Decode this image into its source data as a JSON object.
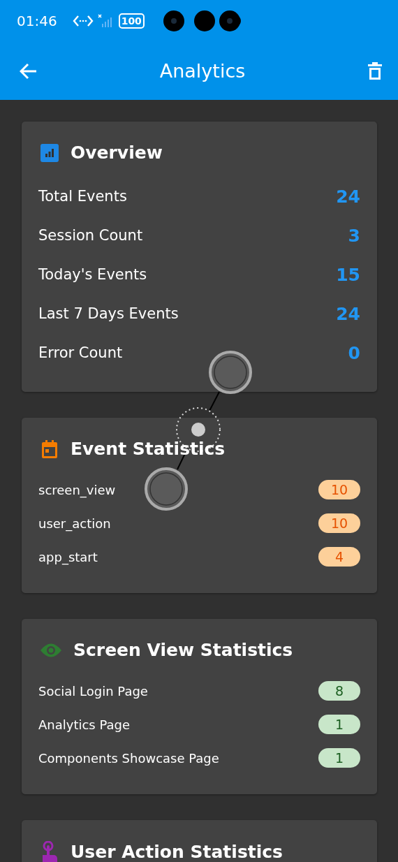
{
  "status_bar": {
    "time": "01:46",
    "battery": "100"
  },
  "app_bar": {
    "title": "Analytics"
  },
  "sections": [
    {
      "kind": "overview",
      "title": "Overview",
      "rows": [
        {
          "label": "Total Events",
          "value": "24"
        },
        {
          "label": "Session Count",
          "value": "3"
        },
        {
          "label": "Today's Events",
          "value": "15"
        },
        {
          "label": "Last 7 Days Events",
          "value": "24"
        },
        {
          "label": "Error Count",
          "value": "0"
        }
      ]
    },
    {
      "kind": "events",
      "title": "Event Statistics",
      "rows": [
        {
          "label": "screen_view",
          "value": "10"
        },
        {
          "label": "user_action",
          "value": "10"
        },
        {
          "label": "app_start",
          "value": "4"
        }
      ]
    },
    {
      "kind": "screens",
      "title": "Screen View Statistics",
      "rows": [
        {
          "label": "Social Login Page",
          "value": "8"
        },
        {
          "label": "Analytics Page",
          "value": "1"
        },
        {
          "label": "Components Showcase Page",
          "value": "1"
        }
      ]
    },
    {
      "kind": "actions",
      "title": "User Action Statistics"
    }
  ]
}
